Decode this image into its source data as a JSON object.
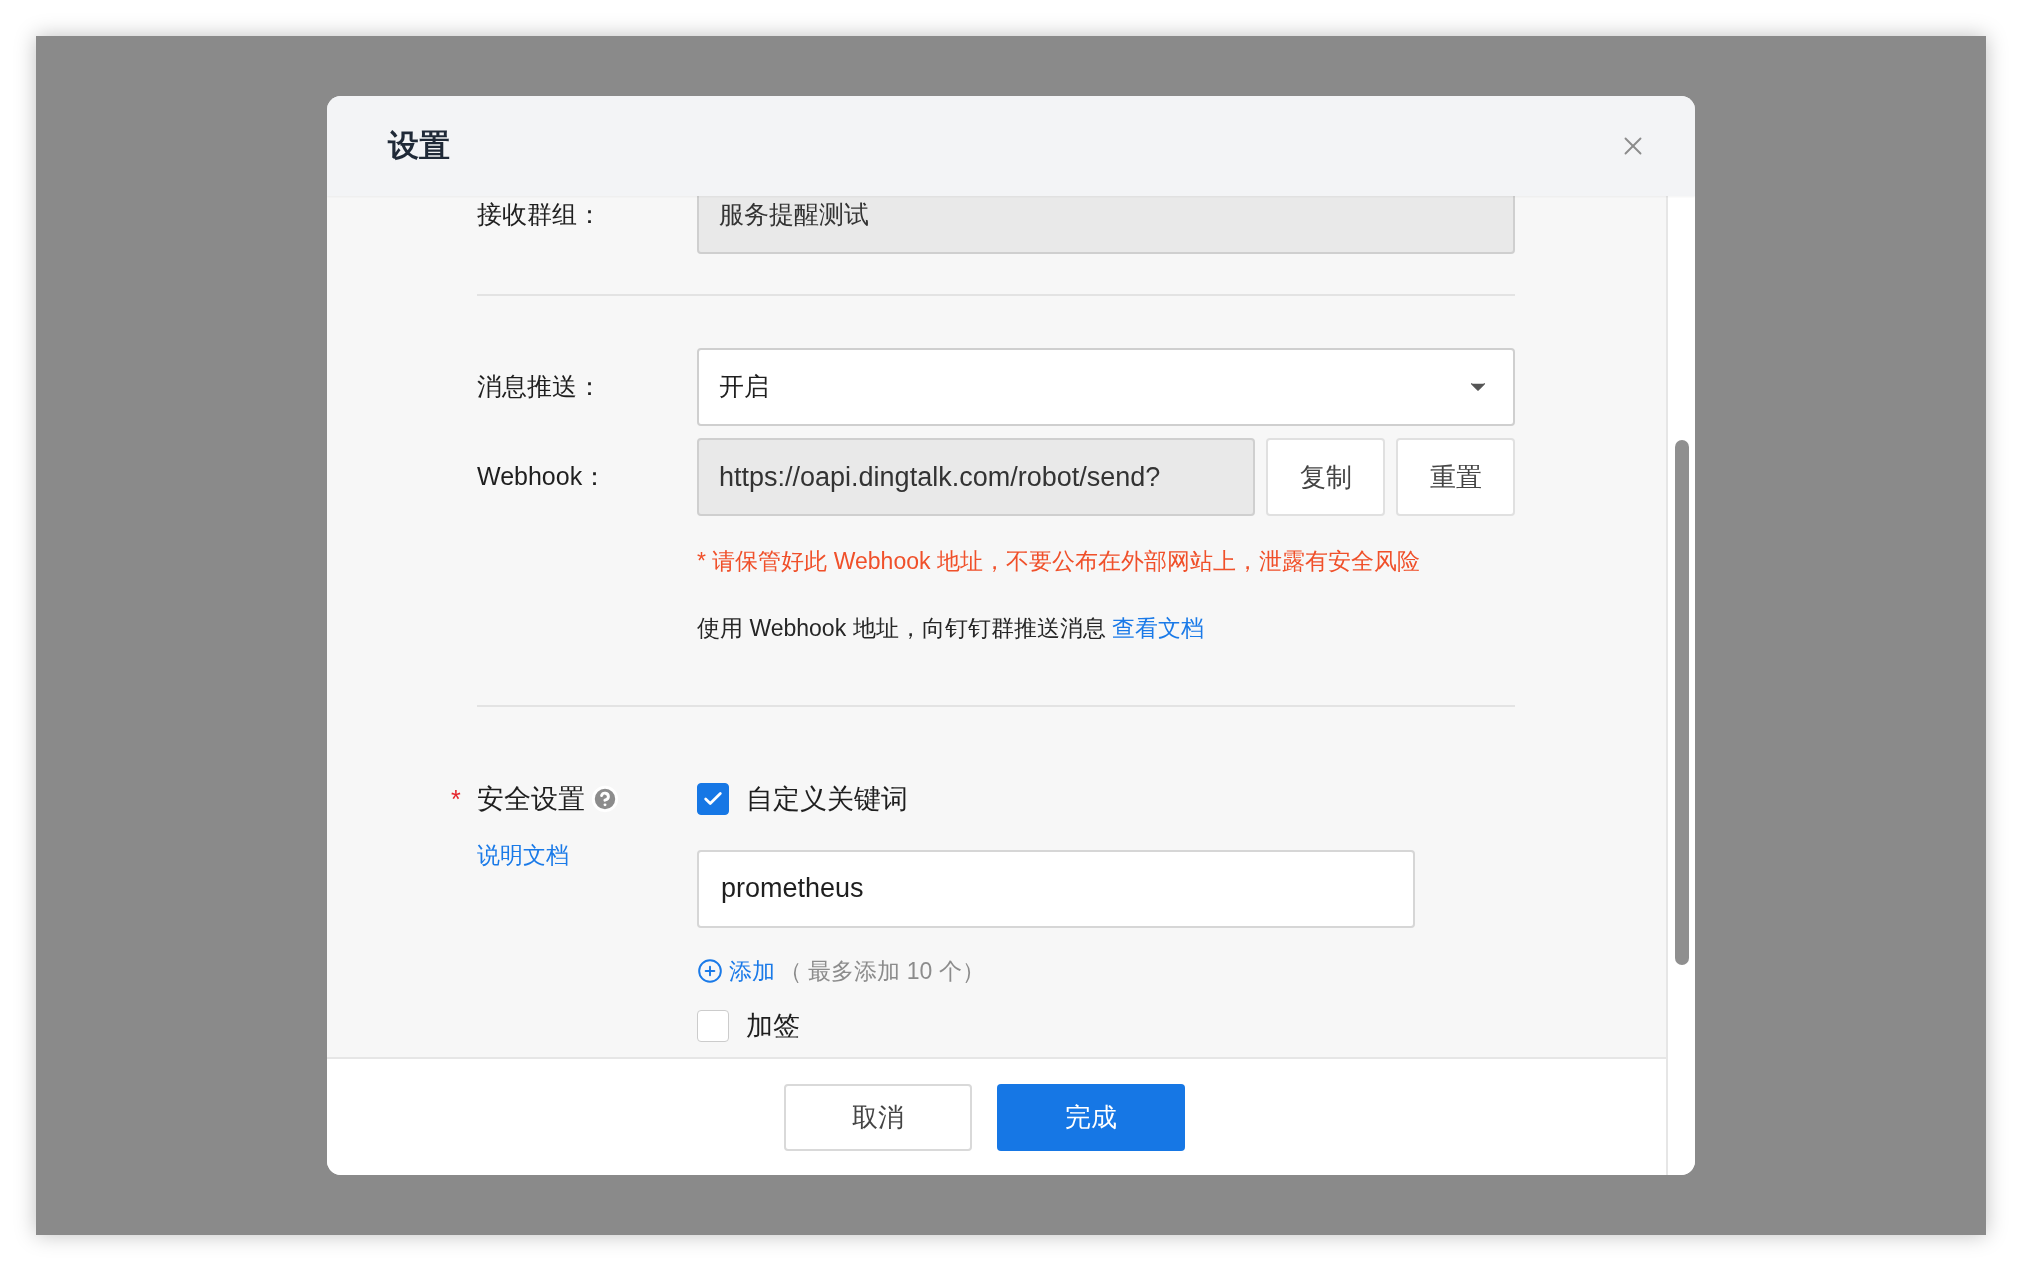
{
  "dialog": {
    "title": "设置"
  },
  "receive_group": {
    "label": "接收群组：",
    "value": "服务提醒测试"
  },
  "message_push": {
    "label": "消息推送：",
    "value": "开启"
  },
  "webhook": {
    "label": "Webhook：",
    "value": "https://oapi.dingtalk.com/robot/send?",
    "buttons": [
      "复制",
      "重置"
    ],
    "warning": "* 请保管好此 Webhook 地址，不要公布在外部网站上，泄露有安全风险",
    "usage": "使用 Webhook 地址，向钉钉群推送消息",
    "usage_link": "查看文档"
  },
  "security": {
    "required_mark": "*",
    "label": "安全设置",
    "doc_link": "说明文档",
    "options": [
      {
        "kind": "keywords",
        "label": "自定义关键词",
        "checked": true,
        "keywords": [
          "prometheus"
        ],
        "add_label": "添加",
        "add_hint": "（ 最多添加 10 个）"
      },
      {
        "kind": "plain",
        "label": "加签",
        "checked": false
      }
    ]
  },
  "footer": {
    "buttons": [
      {
        "label": "取消",
        "primary": false
      },
      {
        "label": "完成",
        "primary": true
      }
    ]
  }
}
